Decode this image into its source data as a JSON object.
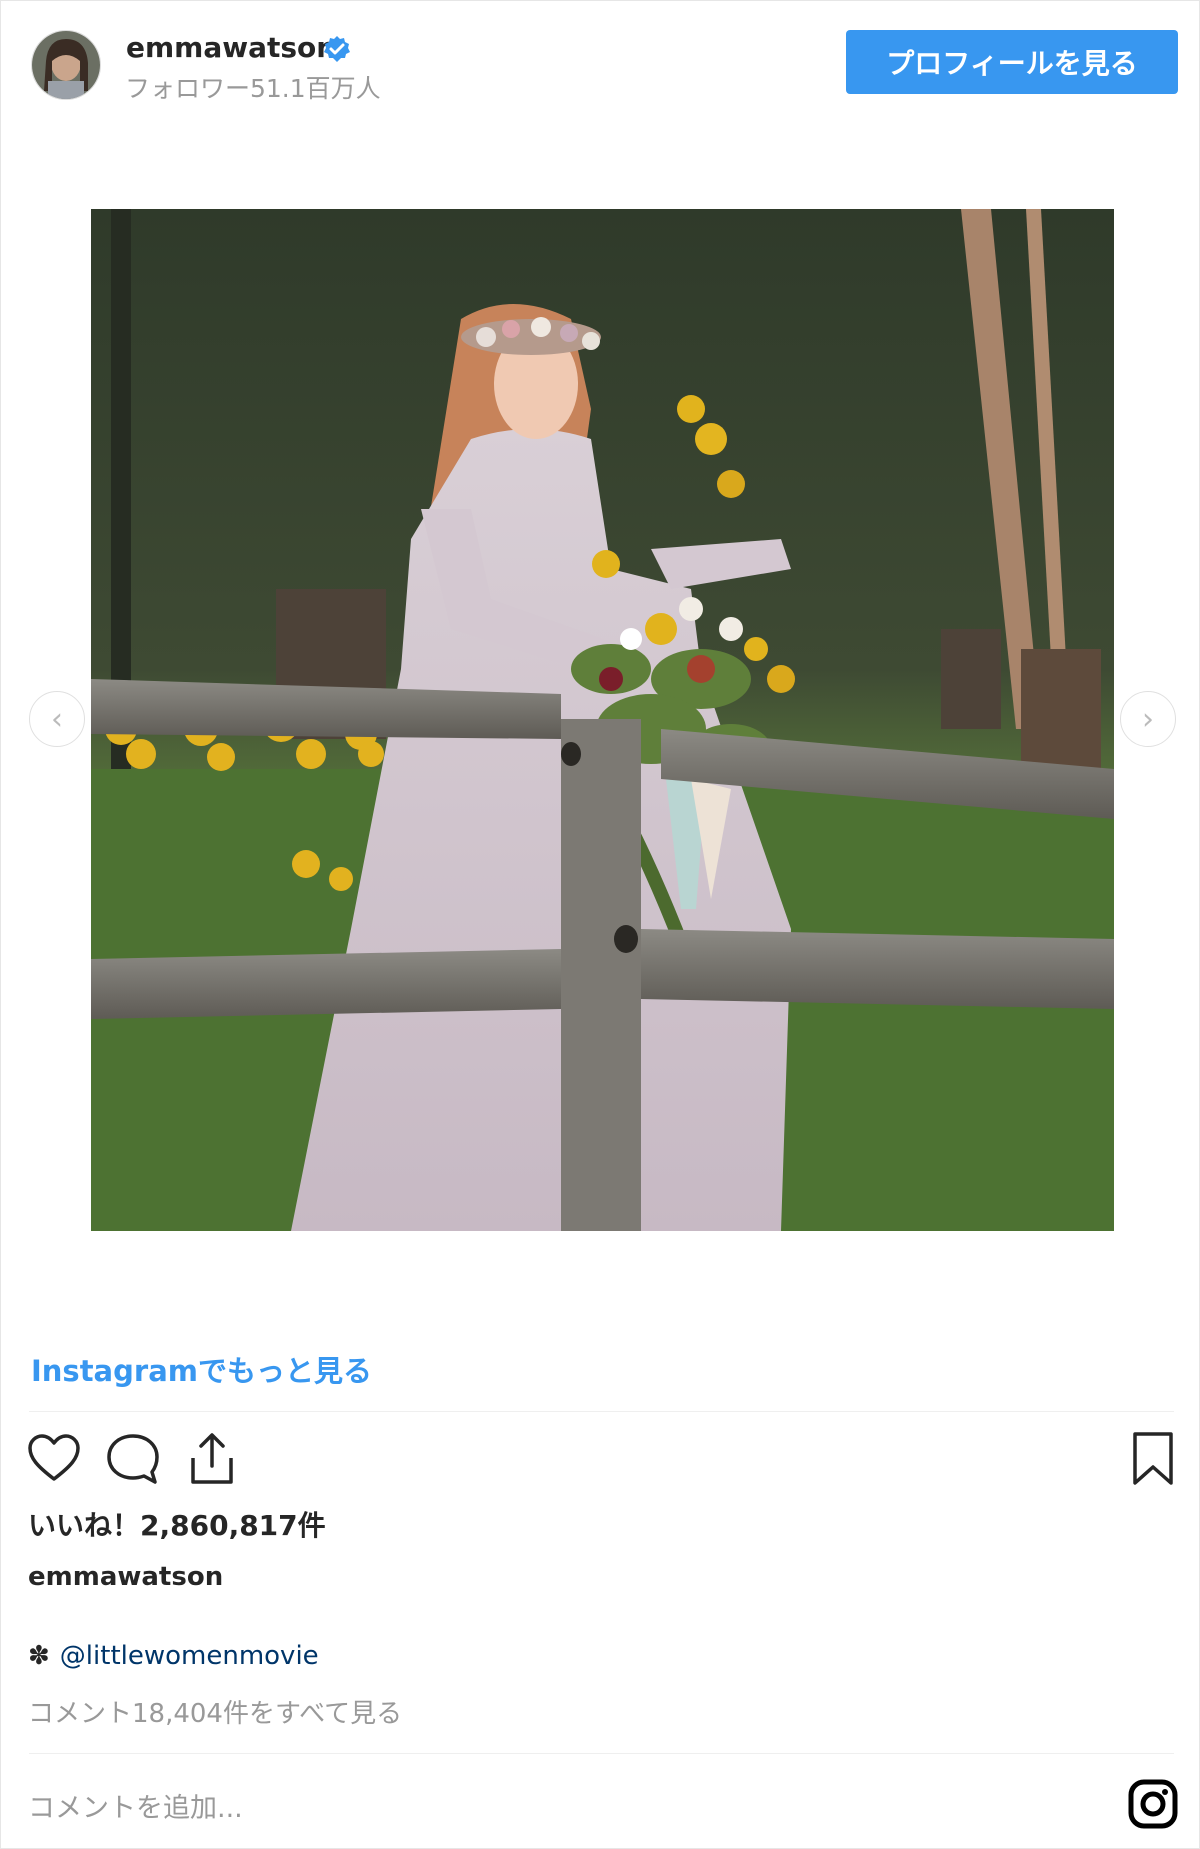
{
  "header": {
    "username": "emmawatson",
    "followers": "フォロワー51.1百万人",
    "profile_button": "プロフィールを見る"
  },
  "post": {
    "more_link": "Instagramでもっと見る",
    "likes": "いいね！2,860,817件",
    "caption_username": "emmawatson",
    "caption_emoji": "✽",
    "caption_mention": "@littlewomenmovie",
    "view_comments": "コメント18,404件をすべて見る",
    "comment_placeholder": "コメントを追加..."
  },
  "colors": {
    "accent": "#3897f0",
    "muted_text": "#999999",
    "mention": "#003569"
  },
  "icons": [
    "verified-badge-icon",
    "chevron-left-icon",
    "chevron-right-icon",
    "heart-icon",
    "comment-icon",
    "share-icon",
    "bookmark-icon",
    "instagram-icon"
  ]
}
